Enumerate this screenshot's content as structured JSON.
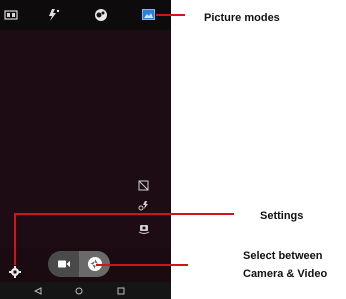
{
  "callouts": {
    "picture_modes": "Picture modes",
    "settings": "Settings",
    "select_line1": "Select between",
    "select_line2": "Camera & Video"
  },
  "colors": {
    "callout_red": "#d1131c",
    "accent_blue": "#2b7fd6"
  },
  "top_icons": [
    "hdr-icon",
    "flash-auto-icon",
    "filter-icon",
    "picture-modes-icon"
  ],
  "side_icons": [
    "grid-off-icon",
    "flash-icon",
    "switch-camera-icon"
  ],
  "nav": [
    "back-icon",
    "home-icon",
    "recents-icon"
  ]
}
